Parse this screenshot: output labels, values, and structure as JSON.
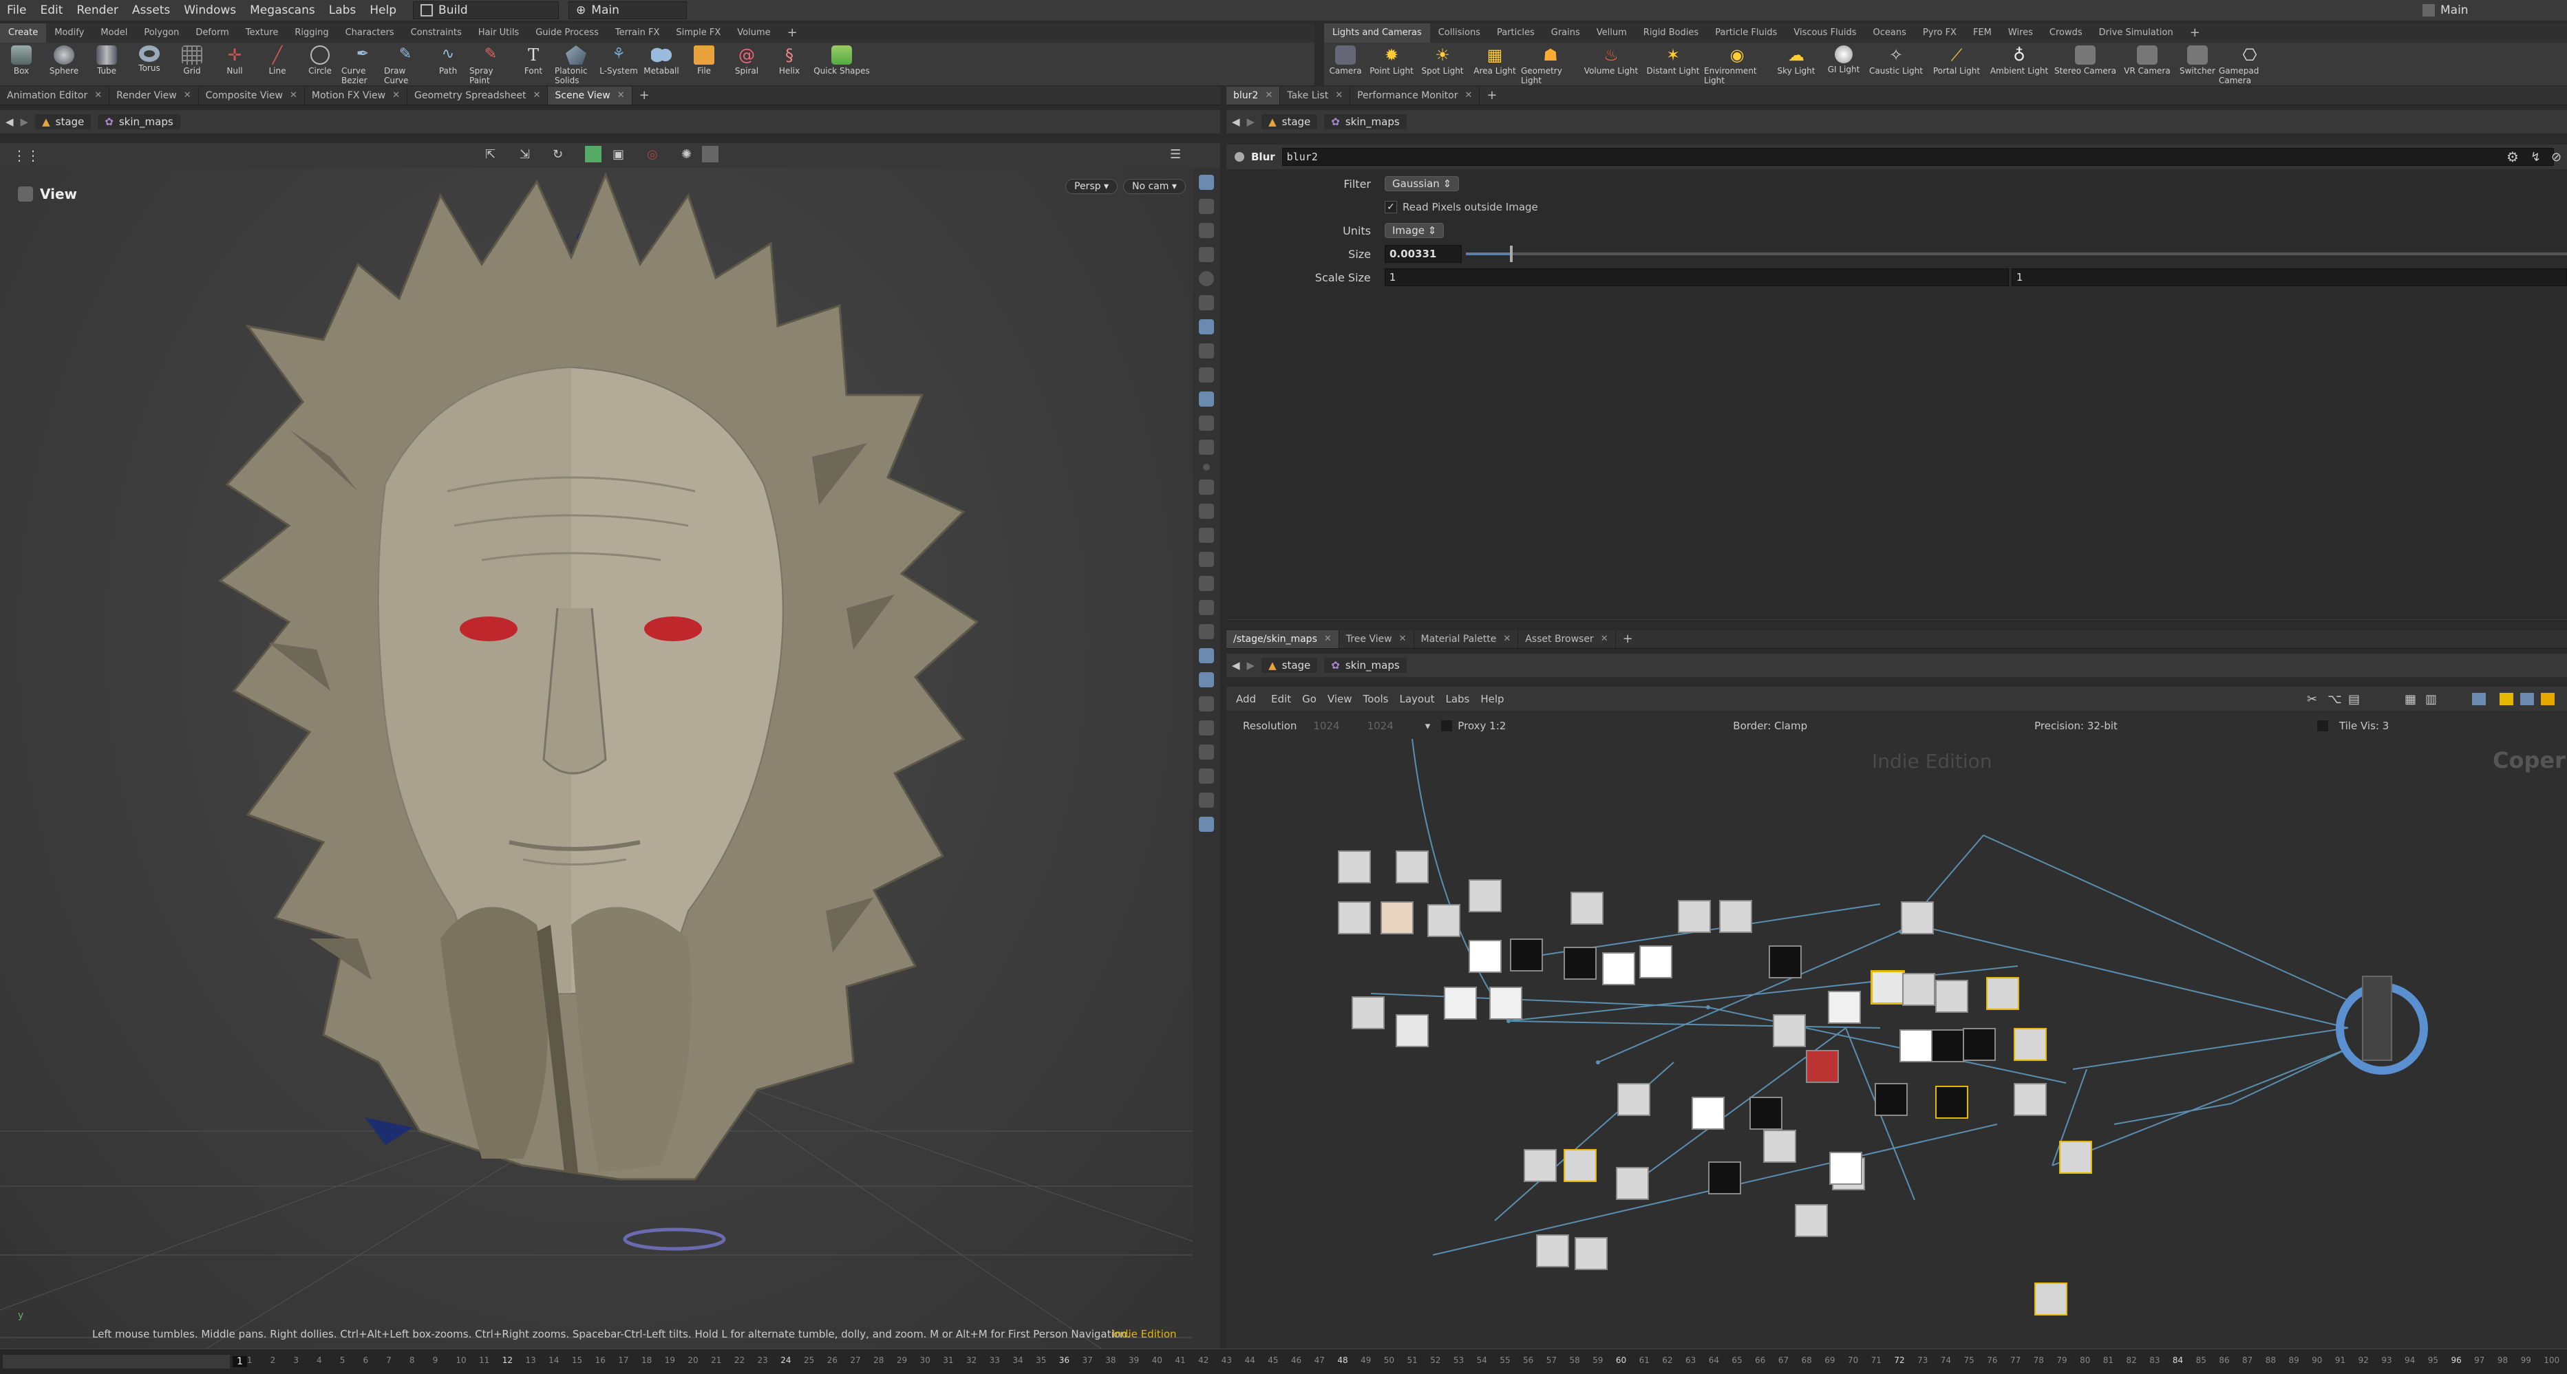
{
  "menu": {
    "items": [
      "File",
      "Edit",
      "Render",
      "Assets",
      "Windows",
      "Megascans",
      "Labs",
      "Help"
    ],
    "desktop": "Build",
    "workspace": "Main",
    "right_title": "Main"
  },
  "shelf_left": {
    "tabs": [
      "Create",
      "Modify",
      "Model",
      "Polygon",
      "Deform",
      "Texture",
      "Rigging",
      "Characters",
      "Constraints",
      "Hair Utils",
      "Guide Process",
      "Terrain FX",
      "Simple FX",
      "Volume"
    ],
    "tools": [
      "Box",
      "Sphere",
      "Tube",
      "Torus",
      "Grid",
      "Null",
      "Line",
      "Circle",
      "Curve Bezier",
      "Draw Curve",
      "Path",
      "Spray Paint",
      "Font",
      "Platonic Solids",
      "L-System",
      "Metaball",
      "File",
      "Spiral",
      "Helix",
      "Quick Shapes"
    ]
  },
  "shelf_right": {
    "tabs": [
      "Lights and Cameras",
      "Collisions",
      "Particles",
      "Grains",
      "Vellum",
      "Rigid Bodies",
      "Particle Fluids",
      "Viscous Fluids",
      "Oceans",
      "Pyro FX",
      "FEM",
      "Wires",
      "Crowds",
      "Drive Simulation"
    ],
    "tools": [
      "Camera",
      "Point Light",
      "Spot Light",
      "Area Light",
      "Geometry Light",
      "Volume Light",
      "Distant Light",
      "Environment Light",
      "Sky Light",
      "GI Light",
      "Caustic Light",
      "Portal Light",
      "Ambient Light",
      "Stereo Camera",
      "VR Camera",
      "Switcher",
      "Gamepad Camera"
    ]
  },
  "left_pane": {
    "tabs": [
      "Animation Editor",
      "Render View",
      "Composite View",
      "Motion FX View",
      "Geometry Spreadsheet",
      "Scene View"
    ],
    "path": [
      "stage",
      "skin_maps"
    ],
    "view_label": "View",
    "persp": "Persp",
    "cam": "No cam",
    "status": "Left mouse tumbles. Middle pans. Right dollies. Ctrl+Alt+Left box-zooms. Ctrl+Right zooms. Spacebar-Ctrl-Left tilts. Hold L for alternate tumble, dolly, and zoom. M or Alt+M for First Person Navigation.",
    "edition": "Indie Edition",
    "axis": "y"
  },
  "param_pane": {
    "tabs": [
      "blur2",
      "Take List",
      "Performance Monitor"
    ],
    "path": [
      "stage",
      "skin_maps"
    ],
    "node_type": "Blur",
    "node_name": "blur2",
    "params": {
      "filter_label": "Filter",
      "filter_value": "Gaussian",
      "read_pixels_label": "Read Pixels outside Image",
      "units_label": "Units",
      "units_value": "Image",
      "size_label": "Size",
      "size_value": "0.00331",
      "scale_label": "Scale Size",
      "scale_x": "1",
      "scale_y": "1"
    },
    "size_slider_fraction": 0.04
  },
  "net_pane": {
    "tabs": [
      "/stage/skin_maps",
      "Tree View",
      "Material Palette",
      "Asset Browser"
    ],
    "path": [
      "stage",
      "skin_maps"
    ],
    "menu": [
      "Add",
      "Edit",
      "Go",
      "View",
      "Tools",
      "Layout",
      "Labs",
      "Help"
    ],
    "info": {
      "resolution_label": "Resolution",
      "res_w": "1024",
      "res_h": "1024",
      "proxy": "Proxy 1:2",
      "border": "Border: Clamp",
      "precision": "Precision: 32-bit",
      "tile_vis": "Tile Vis: 3"
    },
    "watermark": "Indie Edition",
    "context": "Copern"
  },
  "timeline": {
    "current": "1",
    "ticks": [
      "1",
      "2",
      "3",
      "4",
      "5",
      "6",
      "7",
      "8",
      "9",
      "10",
      "11",
      "12",
      "13",
      "14",
      "15",
      "16",
      "17",
      "18",
      "19",
      "20",
      "21",
      "22",
      "23",
      "24",
      "25",
      "26",
      "27",
      "28",
      "29",
      "30",
      "31",
      "32",
      "33",
      "34",
      "35",
      "36",
      "37",
      "38",
      "39",
      "40",
      "41",
      "42",
      "43",
      "44",
      "45",
      "46",
      "47",
      "48",
      "49",
      "50",
      "51",
      "52",
      "53",
      "54",
      "55",
      "56",
      "57",
      "58",
      "59",
      "60",
      "61",
      "62",
      "63",
      "64",
      "65",
      "66",
      "67",
      "68",
      "69",
      "70",
      "71",
      "72",
      "73",
      "74",
      "75",
      "76",
      "77",
      "78",
      "79",
      "80",
      "81",
      "82",
      "83",
      "84",
      "85",
      "86",
      "87",
      "88",
      "89",
      "90",
      "91",
      "92",
      "93",
      "94",
      "95",
      "96",
      "97",
      "98",
      "99",
      "100"
    ]
  },
  "colors": {
    "accent": "#e6b800",
    "wire": "#5a8fb0",
    "eye": "#c0272d",
    "skin": "#b3aa98"
  }
}
